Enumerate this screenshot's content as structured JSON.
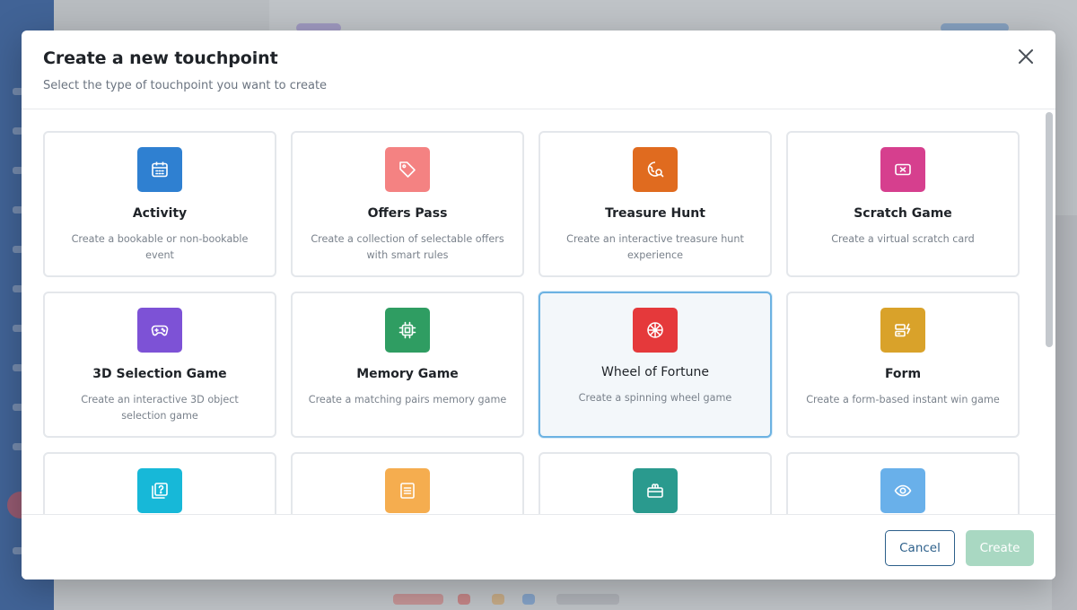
{
  "modal": {
    "title": "Create a new touchpoint",
    "subtitle": "Select the type of touchpoint you want to create",
    "close_icon": "close-icon"
  },
  "cards": [
    {
      "title": "Activity",
      "description": "Create a bookable or non-bookable event",
      "icon": "calendar-icon",
      "color": "#2f80d1",
      "selected": false
    },
    {
      "title": "Offers Pass",
      "description": "Create a collection of selectable offers with smart rules",
      "icon": "tag-icon",
      "color": "#f48282",
      "selected": false
    },
    {
      "title": "Treasure Hunt",
      "description": "Create an interactive treasure hunt experience",
      "icon": "map-search-icon",
      "color": "#e06b1f",
      "selected": false
    },
    {
      "title": "Scratch Game",
      "description": "Create a virtual scratch card",
      "icon": "ticket-icon",
      "color": "#d63f8e",
      "selected": false
    },
    {
      "title": "3D Selection Game",
      "description": "Create an interactive 3D object selection game",
      "icon": "gamepad-icon",
      "color": "#7d52d6",
      "selected": false
    },
    {
      "title": "Memory Game",
      "description": "Create a matching pairs memory game",
      "icon": "chip-icon",
      "color": "#2f9d62",
      "selected": false
    },
    {
      "title": "Wheel of Fortune",
      "description": "Create a spinning wheel game",
      "icon": "wheel-icon",
      "color": "#e5393b",
      "selected": true
    },
    {
      "title": "Form",
      "description": "Create a form-based instant win game",
      "icon": "form-icon",
      "color": "#d9a22a",
      "selected": false
    },
    {
      "title": "",
      "description": "",
      "icon": "quiz-icon",
      "color": "#17b8d8",
      "selected": false
    },
    {
      "title": "",
      "description": "",
      "icon": "document-icon",
      "color": "#f5ad4f",
      "selected": false
    },
    {
      "title": "",
      "description": "",
      "icon": "gift-icon",
      "color": "#2a9a8e",
      "selected": false
    },
    {
      "title": "",
      "description": "",
      "icon": "eye-icon",
      "color": "#69b0ea",
      "selected": false
    }
  ],
  "footer": {
    "cancel_label": "Cancel",
    "create_label": "Create"
  }
}
